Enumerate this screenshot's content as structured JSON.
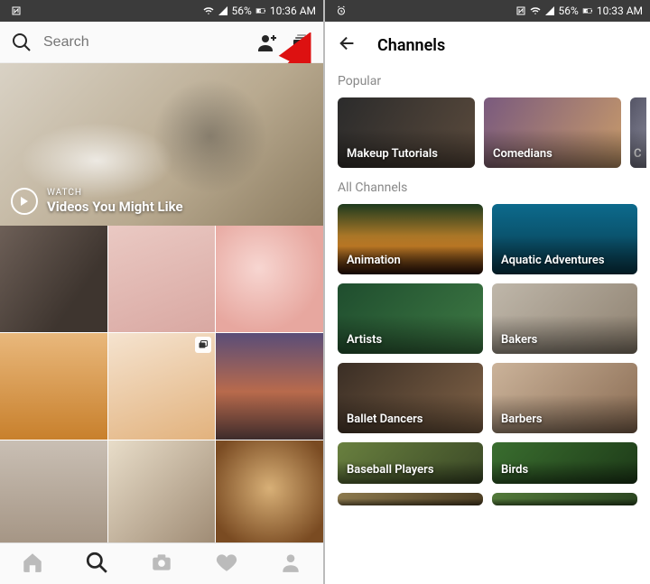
{
  "left": {
    "status": {
      "battery": "56%",
      "time": "10:36 AM"
    },
    "search_placeholder": "Search",
    "hero": {
      "kicker": "WATCH",
      "title": "Videos You Might Like"
    }
  },
  "right": {
    "status": {
      "battery": "56%",
      "time": "10:33 AM"
    },
    "title": "Channels",
    "popular_label": "Popular",
    "all_label": "All Channels",
    "popular": [
      "Makeup Tutorials",
      "Comedians",
      "C"
    ],
    "all": [
      "Animation",
      "Aquatic Adventures",
      "Artists",
      "Bakers",
      "Ballet Dancers",
      "Barbers",
      "Baseball Players",
      "Birds",
      "",
      ""
    ]
  }
}
